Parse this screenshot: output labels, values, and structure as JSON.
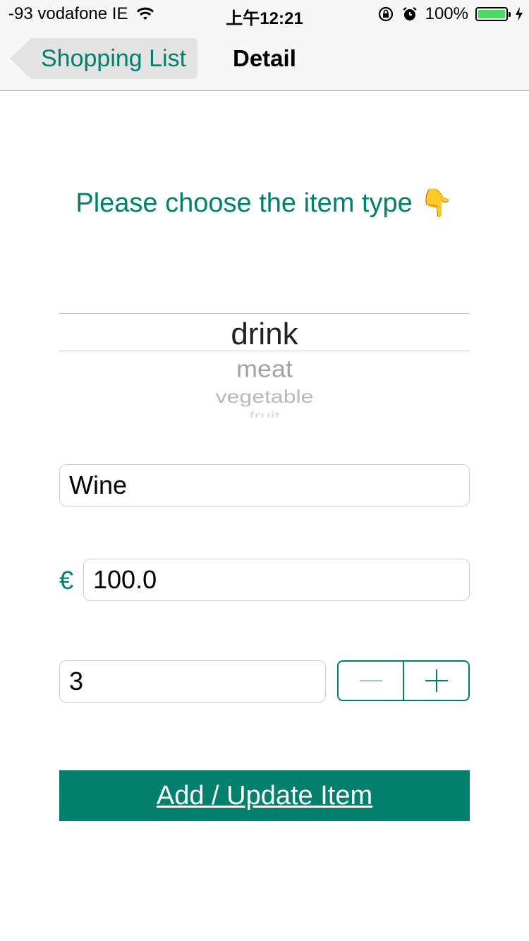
{
  "status_bar": {
    "carrier": "-93 vodafone IE",
    "time": "上午12:21",
    "battery": "100%"
  },
  "nav": {
    "back_label": "Shopping List",
    "title": "Detail"
  },
  "prompt": "Please choose the item type 👇",
  "picker": {
    "selected": "drink",
    "options": [
      "drink",
      "meat",
      "vegetable",
      "fruit"
    ]
  },
  "form": {
    "name_value": "Wine",
    "currency_symbol": "€",
    "price_value": "100.0",
    "quantity_value": "3"
  },
  "actions": {
    "add_update_label": "Add / Update Item"
  },
  "colors": {
    "accent": "#00806d",
    "battery": "#4cd964"
  }
}
